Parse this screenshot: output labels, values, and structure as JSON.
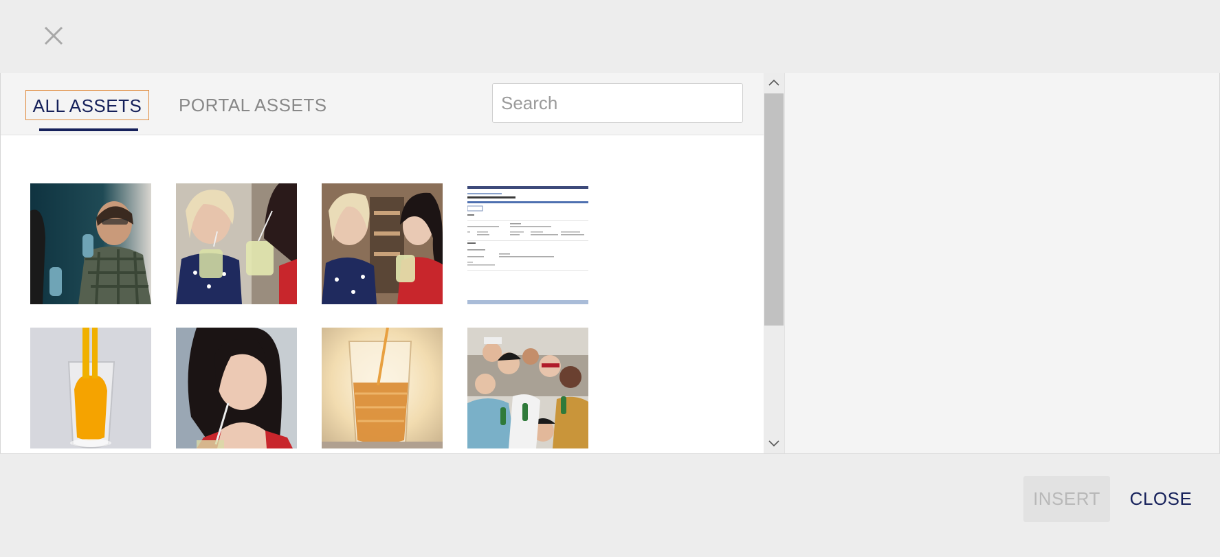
{
  "dialog": {
    "close_icon": "close-icon"
  },
  "tabs": [
    {
      "label": "ALL ASSETS",
      "active": true
    },
    {
      "label": "PORTAL ASSETS",
      "active": false
    }
  ],
  "search": {
    "placeholder": "Search",
    "value": ""
  },
  "assets": [
    {
      "kind": "photo",
      "subject": "man drinking from bottle"
    },
    {
      "kind": "photo",
      "subject": "two women with drinks"
    },
    {
      "kind": "photo",
      "subject": "two women talking"
    },
    {
      "kind": "document",
      "subject": "document page"
    },
    {
      "kind": "photo",
      "subject": "orange juice pouring into glass"
    },
    {
      "kind": "photo",
      "subject": "woman drinking with straw"
    },
    {
      "kind": "photo",
      "subject": "drink pouring into glass"
    },
    {
      "kind": "photo",
      "subject": "group of friends"
    }
  ],
  "footer": {
    "insert_label": "INSERT",
    "insert_enabled": false,
    "close_label": "CLOSE"
  },
  "colors": {
    "accent": "#15205a",
    "focus_border": "#e08a3c",
    "disabled_text": "#b8b8b8"
  }
}
